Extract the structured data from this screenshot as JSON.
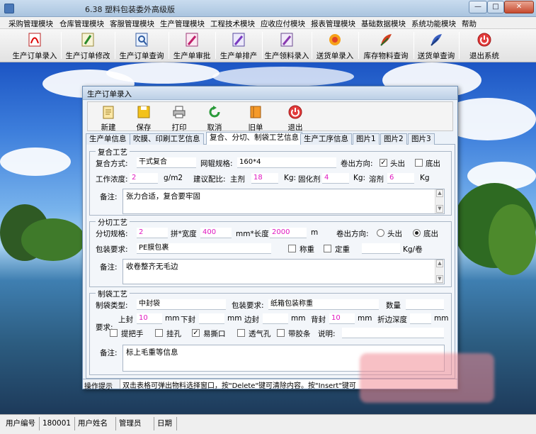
{
  "window": {
    "title": "6.38 塑料包装委外高级版",
    "btn_min": "—",
    "btn_max": "□",
    "btn_close": "✕"
  },
  "menu": [
    "采购管理模块",
    "仓库管理模块",
    "客服管理模块",
    "生产管理模块",
    "工程技术模块",
    "应收应付模块",
    "报表管理模块",
    "基础数据模块",
    "系统功能模块",
    "帮助"
  ],
  "toolbar": [
    "生产订单录入",
    "生产订单修改",
    "生产订单查询",
    "生产单审批",
    "生产单排产",
    "生产领料录入",
    "送货单录入",
    "库存物料查询",
    "送货单查询",
    "退出系统"
  ],
  "child": {
    "title": "生产订单录入",
    "toolbar": [
      "新建",
      "保存",
      "打印",
      "取消",
      "旧单",
      "退出"
    ],
    "tabs": [
      "生产单信息",
      "吹膜、印刷工艺信息",
      "复合、分切、制袋工艺信息",
      "生产工序信息",
      "图片1",
      "图片2",
      "图片3"
    ],
    "laminate": {
      "title": "复合工艺",
      "method_label": "复合方式:",
      "method": "干式复合",
      "spec_label": "网辊规格:",
      "spec": "160*4",
      "roll_dir_label": "卷出方向:",
      "head": "头出",
      "tail": "底出",
      "conc_label": "工作浓度:",
      "conc": "2",
      "conc_unit": "g/m2",
      "ratio_label": "建议配比:",
      "main_label": "主剂",
      "main": "18",
      "kg1": "Kg:",
      "cure_label": "固化剂",
      "cure": "4",
      "kg2": "Kg:",
      "solvent_label": "溶剂",
      "solvent": "6",
      "kg3": "Kg",
      "note_label": "备注:",
      "note": "张力合适，复合要牢固"
    },
    "slit": {
      "title": "分切工艺",
      "spec_label": "分切规格:",
      "count": "2",
      "width_label": "拼*宽度",
      "width": "400",
      "length_label": "mm*长度",
      "length": "2000",
      "m": "m",
      "roll_dir_label": "卷出方向:",
      "head": "头出",
      "tail": "底出",
      "pack_label": "包装要求:",
      "pack": "PE膜包裹",
      "weigh": "称重",
      "fixed": "定重",
      "kg_roll": "Kg/卷",
      "note_label": "备注:",
      "note": "收卷整齐无毛边"
    },
    "bag": {
      "title": "制袋工艺",
      "type_label": "制袋类型:",
      "type": "中封袋",
      "pack_label": "包装要求:",
      "pack": "纸箱包装称重",
      "qty_label": "数量",
      "req_label": "要求:",
      "top_label": "上封",
      "top": "10",
      "mm": "mm",
      "bottom_label": "下封",
      "side_label": "边封",
      "back_label": "背封",
      "back": "10",
      "fold_label": "折边深度",
      "handle": "提把手",
      "hang": "挂孔",
      "tear": "易撕口",
      "vent": "透气孔",
      "strip": "带胶条",
      "desc_label": "说明:",
      "note_label": "备注:",
      "note": "标上毛重等信息"
    },
    "hint_label": "操作提示",
    "hint": "双击表格可弹出物料选择窗口，按\"Delete\"键可清除内容。按\"Insert\"键可"
  },
  "status": [
    {
      "label": "用户编号",
      "value": "180001"
    },
    {
      "label": "用户姓名",
      "value": "管理员"
    },
    {
      "label": "日期",
      "value": ""
    }
  ]
}
